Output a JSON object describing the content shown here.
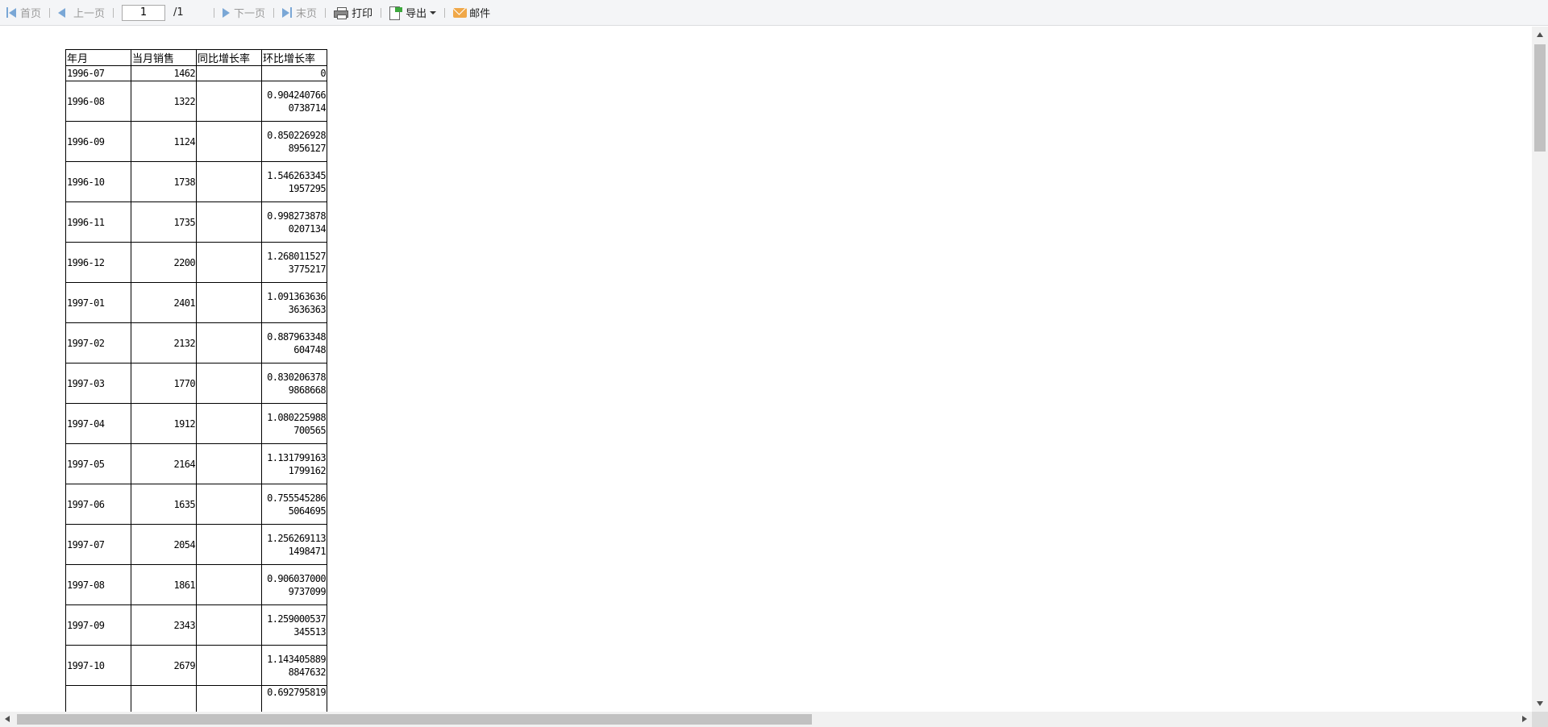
{
  "toolbar": {
    "first_label": "首页",
    "prev_label": "上一页",
    "page_value": "1",
    "page_total": "/1",
    "next_label": "下一页",
    "last_label": "末页",
    "print_label": "打印",
    "export_label": "导出",
    "mail_label": "邮件"
  },
  "table": {
    "headers": [
      "年月",
      "当月销售",
      "同比增长率",
      "环比增长率"
    ],
    "rows": [
      {
        "month": "1996-07",
        "sales": "1462",
        "yoy": "",
        "mom": "0"
      },
      {
        "month": "1996-08",
        "sales": "1322",
        "yoy": "",
        "mom": "0.9042407660738714"
      },
      {
        "month": "1996-09",
        "sales": "1124",
        "yoy": "",
        "mom": "0.8502269288956127"
      },
      {
        "month": "1996-10",
        "sales": "1738",
        "yoy": "",
        "mom": "1.5462633451957295"
      },
      {
        "month": "1996-11",
        "sales": "1735",
        "yoy": "",
        "mom": "0.9982738780207134"
      },
      {
        "month": "1996-12",
        "sales": "2200",
        "yoy": "",
        "mom": "1.2680115273775217"
      },
      {
        "month": "1997-01",
        "sales": "2401",
        "yoy": "",
        "mom": "1.0913636363636363"
      },
      {
        "month": "1997-02",
        "sales": "2132",
        "yoy": "",
        "mom": "0.887963348604748"
      },
      {
        "month": "1997-03",
        "sales": "1770",
        "yoy": "",
        "mom": "0.8302063789868668"
      },
      {
        "month": "1997-04",
        "sales": "1912",
        "yoy": "",
        "mom": "1.080225988700565"
      },
      {
        "month": "1997-05",
        "sales": "2164",
        "yoy": "",
        "mom": "1.1317991631799162"
      },
      {
        "month": "1997-06",
        "sales": "1635",
        "yoy": "",
        "mom": "0.7555452865064695"
      },
      {
        "month": "1997-07",
        "sales": "2054",
        "yoy": "",
        "mom": "1.2562691131498471"
      },
      {
        "month": "1997-08",
        "sales": "1861",
        "yoy": "",
        "mom": "0.9060370009737099"
      },
      {
        "month": "1997-09",
        "sales": "2343",
        "yoy": "",
        "mom": "1.259000537345513"
      },
      {
        "month": "1997-10",
        "sales": "2679",
        "yoy": "",
        "mom": "1.1434058898847632"
      },
      {
        "month": "",
        "sales": "",
        "yoy": "",
        "mom": "0.692795819"
      }
    ]
  }
}
